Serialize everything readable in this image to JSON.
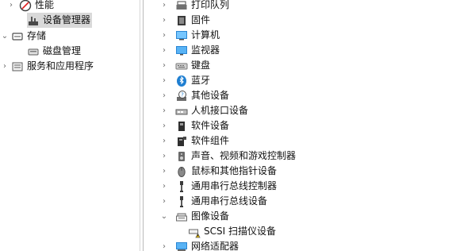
{
  "left_tree": {
    "items": [
      {
        "label": "性能",
        "expander": "›",
        "icon": "performance-icon"
      },
      {
        "label": "设备管理器",
        "expander": "",
        "icon": "device-manager-icon"
      },
      {
        "label": "存储",
        "expander": "⌄",
        "icon": "storage-icon"
      },
      {
        "label": "磁盘管理",
        "expander": "",
        "icon": "disk-management-icon"
      },
      {
        "label": "服务和应用程序",
        "expander": "›",
        "icon": "services-icon"
      }
    ]
  },
  "device_tree": {
    "items": [
      {
        "label": "打印队列",
        "expander": "›",
        "icon": "printer-icon"
      },
      {
        "label": "固件",
        "expander": "›",
        "icon": "firmware-icon"
      },
      {
        "label": "计算机",
        "expander": "›",
        "icon": "computer-icon"
      },
      {
        "label": "监视器",
        "expander": "›",
        "icon": "monitor-icon"
      },
      {
        "label": "键盘",
        "expander": "›",
        "icon": "keyboard-icon"
      },
      {
        "label": "蓝牙",
        "expander": "›",
        "icon": "bluetooth-icon"
      },
      {
        "label": "其他设备",
        "expander": "›",
        "icon": "other-devices-icon"
      },
      {
        "label": "人机接口设备",
        "expander": "›",
        "icon": "hid-icon"
      },
      {
        "label": "软件设备",
        "expander": "›",
        "icon": "software-device-icon"
      },
      {
        "label": "软件组件",
        "expander": "›",
        "icon": "software-component-icon"
      },
      {
        "label": "声音、视频和游戏控制器",
        "expander": "›",
        "icon": "speaker-icon"
      },
      {
        "label": "鼠标和其他指针设备",
        "expander": "›",
        "icon": "mouse-icon"
      },
      {
        "label": "通用串行总线控制器",
        "expander": "›",
        "icon": "usb-controller-icon"
      },
      {
        "label": "通用串行总线设备",
        "expander": "›",
        "icon": "usb-device-icon"
      },
      {
        "label": "图像设备",
        "expander": "⌄",
        "icon": "imaging-device-icon"
      },
      {
        "label": "SCSI 扫描仪设备",
        "expander": "",
        "icon": "scanner-warning-icon"
      },
      {
        "label": "网络适配器",
        "expander": "›",
        "icon": "network-adapter-icon"
      }
    ]
  },
  "colors": {
    "selection": "#d9d9d9",
    "accent_blue": "#2b86d3",
    "warning_yellow": "#f5c400"
  }
}
